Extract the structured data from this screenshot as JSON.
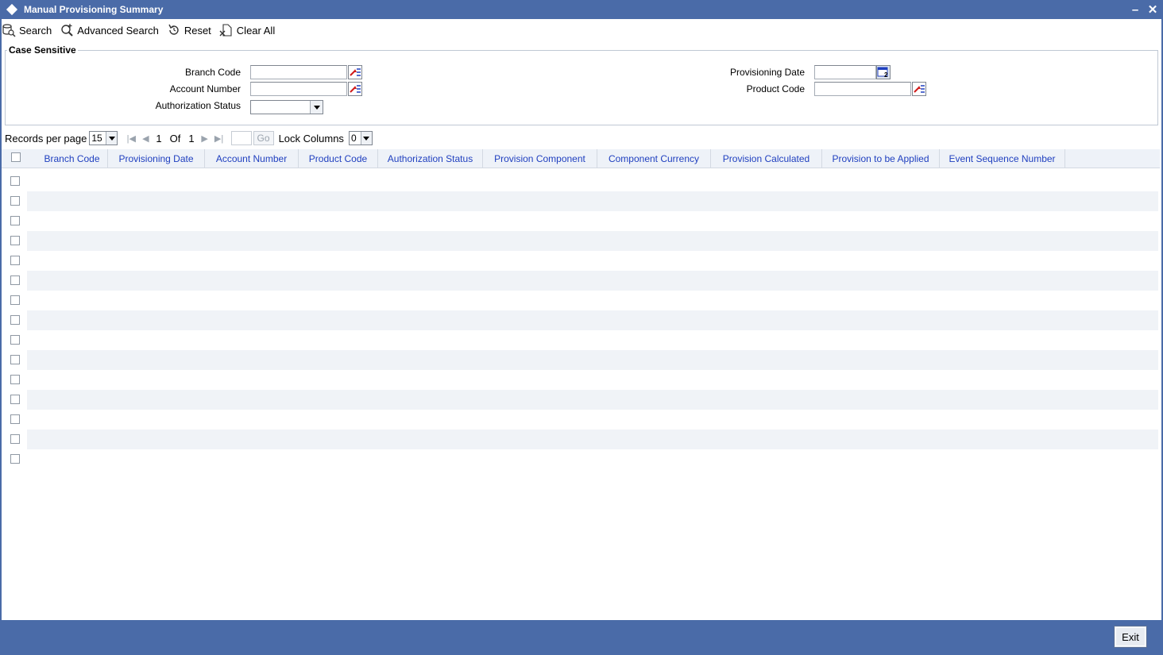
{
  "window": {
    "title": "Manual Provisioning Summary",
    "minimize_label": "–",
    "close_label": "✕"
  },
  "toolbar": {
    "search_label": "Search",
    "advanced_search_label": "Advanced Search",
    "reset_label": "Reset",
    "clear_all_label": "Clear All"
  },
  "criteria": {
    "legend": "Case Sensitive",
    "branch_code_label": "Branch Code",
    "branch_code_value": "",
    "account_number_label": "Account Number",
    "account_number_value": "",
    "authorization_status_label": "Authorization Status",
    "authorization_status_value": "",
    "provisioning_date_label": "Provisioning Date",
    "provisioning_date_value": "",
    "product_code_label": "Product Code",
    "product_code_value": ""
  },
  "pager": {
    "records_per_page_label": "Records per page",
    "records_per_page_value": "15",
    "current_page": "1",
    "of_label": "Of",
    "total_pages": "1",
    "go_label": "Go",
    "lock_columns_label": "Lock Columns",
    "lock_columns_value": "0"
  },
  "grid": {
    "columns": [
      "Branch Code",
      "Provisioning Date",
      "Account Number",
      "Product Code",
      "Authorization Status",
      "Provision Component",
      "Component Currency",
      "Provision Calculated",
      "Provision to be Applied",
      "Event Sequence Number"
    ],
    "row_count": 15
  },
  "footer": {
    "exit_label": "Exit"
  },
  "colors": {
    "title_bar": "#4a6ba8",
    "column_header_text": "#1f3fbf",
    "alt_row": "#f0f3f7"
  }
}
